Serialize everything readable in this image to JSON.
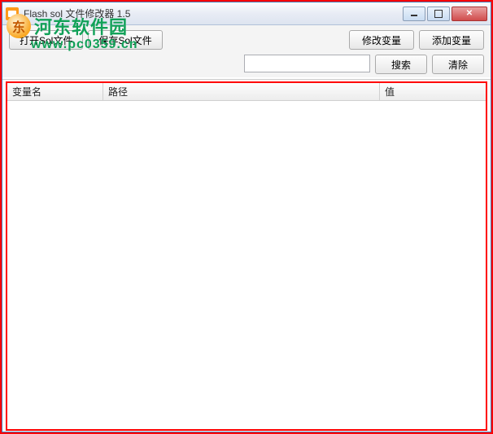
{
  "window": {
    "title": "Flash sol 文件修改器 1.5"
  },
  "toolbar": {
    "open_label": "打开Sol文件",
    "save_label": "保存Sol文件",
    "modify_label": "修改变量",
    "add_label": "添加变量",
    "search_label": "搜索",
    "clear_label": "清除",
    "search_value": ""
  },
  "table": {
    "headers": {
      "name": "变量名",
      "path": "路径",
      "value": "值"
    },
    "rows": []
  },
  "watermark": {
    "text": "河东软件园",
    "url": "www.pc0359.cn"
  }
}
